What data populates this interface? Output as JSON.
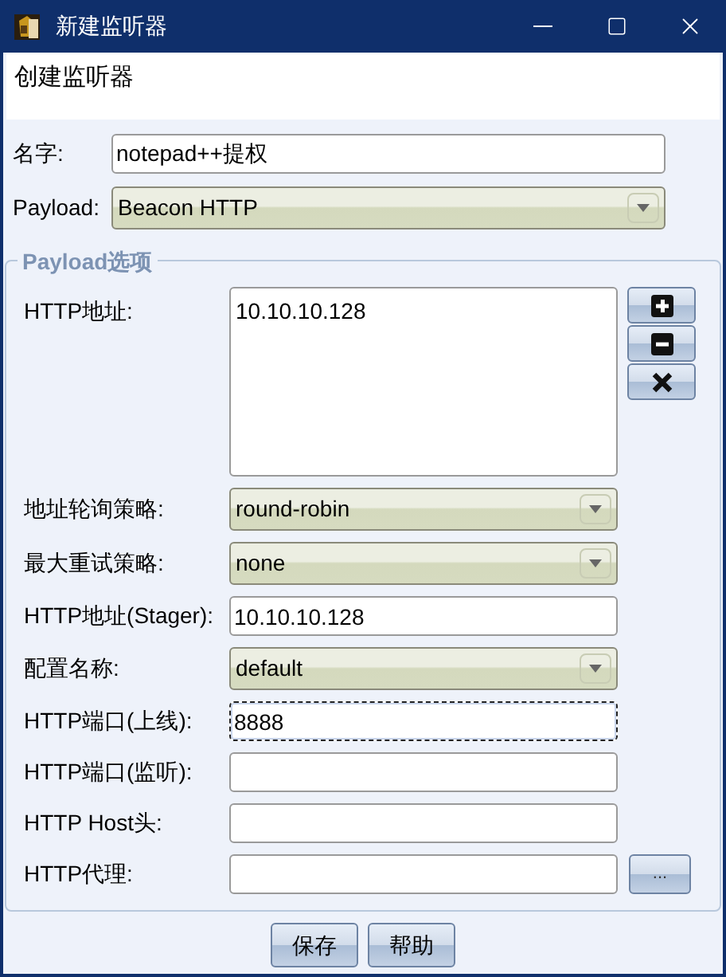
{
  "window": {
    "title": "新建监听器"
  },
  "header": {
    "text": "创建监听器"
  },
  "top_fields": [
    {
      "label": "名字:",
      "kind": "text",
      "value": "notepad++提权",
      "focused": false
    },
    {
      "label": "Payload:",
      "kind": "select",
      "value": "Beacon HTTP",
      "focused": false
    }
  ],
  "options": {
    "title": "Payload选项",
    "fields": [
      {
        "label": "HTTP地址:",
        "kind": "list",
        "lines": [
          "10.10.10.128"
        ],
        "focused": false
      },
      {
        "label": "地址轮询策略:",
        "kind": "select",
        "value": "round-robin",
        "focused": false
      },
      {
        "label": "最大重试策略:",
        "kind": "select",
        "value": "none",
        "focused": false
      },
      {
        "label": "HTTP地址(Stager):",
        "kind": "text",
        "value": "10.10.10.128",
        "focused": false
      },
      {
        "label": "配置名称:",
        "kind": "select",
        "value": "default",
        "focused": false
      },
      {
        "label": "HTTP端口(上线):",
        "kind": "text",
        "value": "8888",
        "focused": true
      },
      {
        "label": "HTTP端口(监听):",
        "kind": "text",
        "focused": false
      },
      {
        "label": "HTTP Host头:",
        "kind": "text",
        "focused": false
      },
      {
        "label": "HTTP代理:",
        "kind": "text",
        "focused": false,
        "button": "..."
      }
    ]
  },
  "buttons": [
    "保存",
    "帮助"
  ]
}
